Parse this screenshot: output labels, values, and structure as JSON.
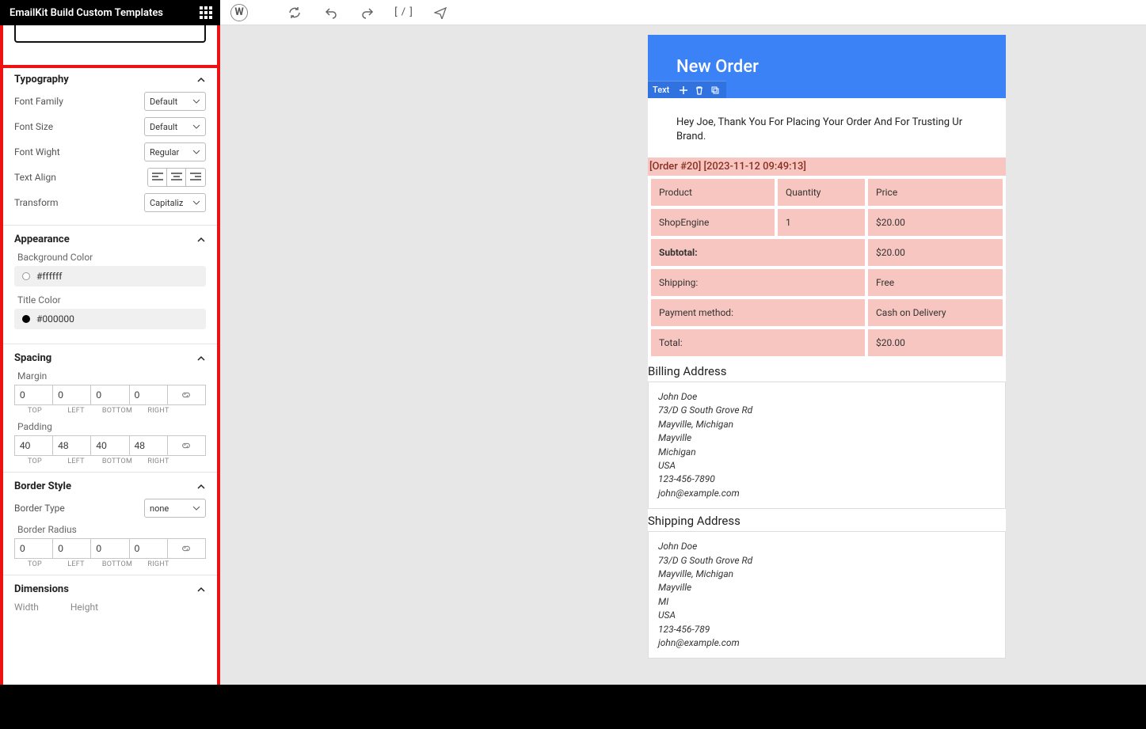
{
  "brand": {
    "title": "EmailKit Build Custom Templates"
  },
  "toolbar": {
    "shortcode": "[ / ]"
  },
  "panel": {
    "typography": {
      "title": "Typography",
      "font_family_label": "Font Family",
      "font_family_value": "Default",
      "font_size_label": "Font Size",
      "font_size_value": "Default",
      "font_weight_label": "Font Wight",
      "font_weight_value": "Regular",
      "text_align_label": "Text Align",
      "transform_label": "Transform",
      "transform_value": "Capitaliz"
    },
    "appearance": {
      "title": "Appearance",
      "bg_label": "Background Color",
      "bg_value": "#ffffff",
      "title_color_label": "Title Color",
      "title_color_value": "#000000"
    },
    "spacing": {
      "title": "Spacing",
      "margin_label": "Margin",
      "margin": {
        "top": "0",
        "left": "0",
        "bottom": "0",
        "right": "0"
      },
      "padding_label": "Padding",
      "padding": {
        "top": "40",
        "left": "48",
        "bottom": "40",
        "right": "48"
      },
      "labels": {
        "top": "TOP",
        "left": "LEFT",
        "bottom": "BOTTOM",
        "right": "RIGHT"
      }
    },
    "border": {
      "title": "Border Style",
      "type_label": "Border Type",
      "type_value": "none",
      "radius_label": "Border Radius",
      "radius": {
        "top": "0",
        "left": "0",
        "bottom": "0",
        "right": "0"
      }
    },
    "dimensions": {
      "title": "Dimensions",
      "width_label": "Width",
      "height_label": "Height"
    }
  },
  "email": {
    "header_title": "New Order",
    "sel_label": "Text",
    "greeting": "Hey Joe, Thank You For Placing Your Order And For Trusting Ur Brand.",
    "order_meta": "[Order #20] [2023-11-12 09:49:13]",
    "table": {
      "headers": {
        "product": "Product",
        "quantity": "Quantity",
        "price": "Price"
      },
      "rows": [
        {
          "product": "ShopEngine",
          "quantity": "1",
          "price": "$20.00"
        }
      ],
      "totals": [
        {
          "label": "Subtotal:",
          "value": "$20.00",
          "bold": true
        },
        {
          "label": "Shipping:",
          "value": "Free"
        },
        {
          "label": "Payment method:",
          "value": "Cash on Delivery"
        },
        {
          "label": "Total:",
          "value": "$20.00"
        }
      ]
    },
    "billing": {
      "title": "Billing Address",
      "lines": [
        "John Doe",
        "73/D G South Grove Rd",
        "Mayville, Michigan",
        "Mayville",
        "Michigan",
        "USA",
        "123-456-7890",
        "john@example.com"
      ]
    },
    "shipping": {
      "title": "Shipping Address",
      "lines": [
        "John Doe",
        "73/D G South Grove Rd",
        "Mayville, Michigan",
        "Mayville",
        "MI",
        "USA",
        "123-456-789",
        "john@example.com"
      ]
    }
  }
}
